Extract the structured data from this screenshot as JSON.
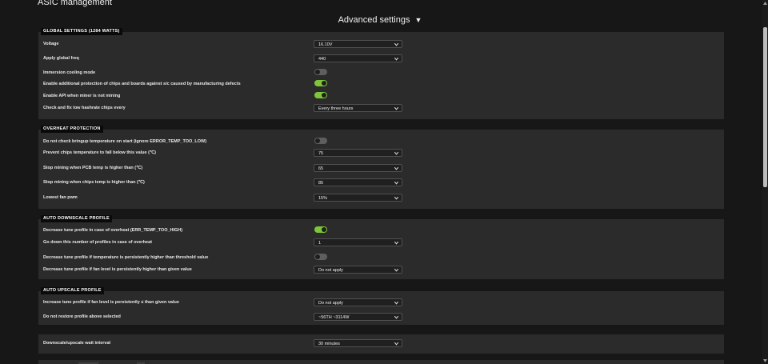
{
  "app": {
    "title": "ASIC management"
  },
  "header": {
    "title": "Advanced settings",
    "arrow": "▼"
  },
  "global": {
    "section": "GLOBAL SETTINGS (1284 WATTS)",
    "voltage": {
      "label": "Voltage",
      "value": "16.10V"
    },
    "freq": {
      "label": "Apply global freq",
      "value": "440"
    },
    "immersion": {
      "label": "Immersion cooling mode",
      "enabled": false
    },
    "protection": {
      "label": "Enable additional protection of chips and boards against s/c caused by manufacturing defects",
      "enabled": true
    },
    "api": {
      "label": "Enable API when miner is not mining",
      "enabled": true
    },
    "lowhash": {
      "label": "Check and fix low hashrate chips every",
      "value": "Every three hours"
    }
  },
  "overheat": {
    "section": "OVERHEAT PROTECTION",
    "bringup": {
      "label": "Do not check bringup temperature on start (ignore ERROR_TEMP_TOO_LOW)",
      "enabled": false
    },
    "prevent": {
      "label": "Prevent chips temperature to fall below this value (℃)",
      "value": "75"
    },
    "pcb": {
      "label": "Stop mining when PCB temp is higher than (℃)",
      "value": "65"
    },
    "chips": {
      "label": "Stop mining when chips temp is higher than (℃)",
      "value": "85"
    },
    "fan": {
      "label_prefix": "Lowest",
      "label_bold": "fan",
      "label_suffix": "pwm",
      "value": "15%"
    }
  },
  "downscale": {
    "section": "AUTO DOWNSCALE PROFILE",
    "decrease_overheat": {
      "label": "Decrease tune profile in case of overheat (ERR_TEMP_TOO_HIGH)",
      "enabled": true
    },
    "go_down": {
      "label": "Go down this number of profiles in case of overheat",
      "value": "1"
    },
    "temp_threshold": {
      "label": "Decrease tune profile if temperature is persistently higher than threshold value",
      "enabled": false
    },
    "fan_level": {
      "label_prefix": "Decrease tune profile if",
      "label_bold": "fan",
      "label_suffix": "level is persistently higher than given value",
      "value": "Do not apply"
    }
  },
  "upscale": {
    "section": "AUTO UPSCALE PROFILE",
    "increase": {
      "label_prefix": "Increase tune profile if",
      "label_bold": "fan",
      "label_suffix": "level is persistently ≤ than given value",
      "value": "Do not apply"
    },
    "restore": {
      "label": "Do not restore profile above selected",
      "value": "~56TH ~3114W"
    }
  },
  "interval": {
    "label": "Downscale/upscale wait interval",
    "value": "30 minutes"
  },
  "colors": {
    "accent_on": "#7fc53a",
    "panel": "#2b2b2b",
    "background": "#171717"
  },
  "icons": {
    "select_chevron": "chevron-down-icon",
    "toggle": "toggle-switch"
  }
}
